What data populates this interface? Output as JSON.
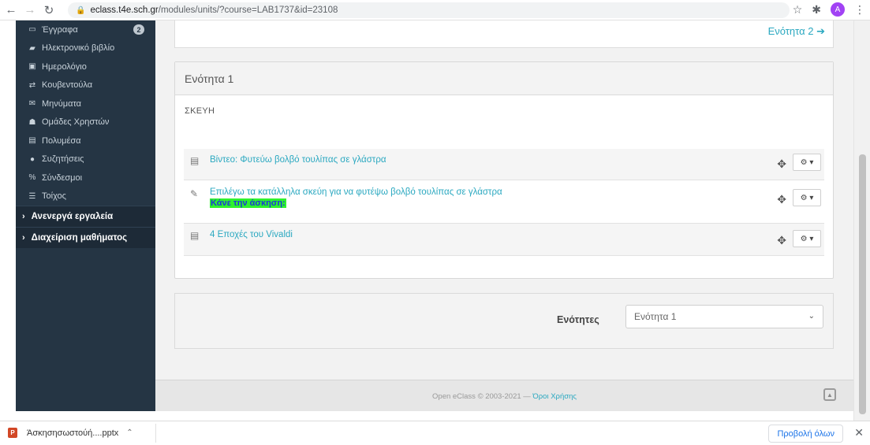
{
  "browser": {
    "url_host": "eclass.t4e.sch.gr",
    "url_path": "/modules/units/?course=LAB1737&id=23108",
    "avatar_letter": "A"
  },
  "sidebar": {
    "items": [
      {
        "label": "Έγγραφα",
        "icon": "folder-icon",
        "glyph": "▭",
        "badge": "2"
      },
      {
        "label": "Ηλεκτρονικό βιβλίο",
        "icon": "book-icon",
        "glyph": "▰"
      },
      {
        "label": "Ημερολόγιο",
        "icon": "calendar-icon",
        "glyph": "▣"
      },
      {
        "label": "Κουβεντούλα",
        "icon": "exchange-icon",
        "glyph": "⇄"
      },
      {
        "label": "Μηνύματα",
        "icon": "envelope-icon",
        "glyph": "✉"
      },
      {
        "label": "Ομάδες Χρηστών",
        "icon": "users-icon",
        "glyph": "☗"
      },
      {
        "label": "Πολυμέσα",
        "icon": "film-icon",
        "glyph": "▤"
      },
      {
        "label": "Συζητήσεις",
        "icon": "comments-icon",
        "glyph": "●"
      },
      {
        "label": "Σύνδεσμοι",
        "icon": "link-icon",
        "glyph": "%"
      },
      {
        "label": "Τοίχος",
        "icon": "list-icon",
        "glyph": "☰"
      }
    ],
    "groups": [
      {
        "label": "Ανενεργά εργαλεία"
      },
      {
        "label": "Διαχείριση μαθήματος"
      }
    ]
  },
  "main": {
    "next_unit_link": "Ενότητα 2",
    "unit_title": "Ενότητα 1",
    "unit_description": "ΣΚΕΥΗ",
    "resources": [
      {
        "title": "Βίντεο: Φυτεύω βολβό τουλίπας σε γλάστρα",
        "icon": "film-icon",
        "glyph": "▤"
      },
      {
        "title": "Επιλέγω τα κατάλληλα σκεύη για να φυτέψω βολβό τουλίπας σε γλάστρα",
        "icon": "edit-icon",
        "glyph": "✎",
        "highlight": "Κάνε την άσκηση:"
      },
      {
        "title": "4 Εποχές του Vivaldi",
        "icon": "film-icon",
        "glyph": "▤"
      }
    ],
    "units_label": "Ενότητες",
    "units_select_value": "Ενότητα 1"
  },
  "footer": {
    "copyright": "Open eClass © 2003-2021 — ",
    "terms": "Όροι Χρήσης"
  },
  "download_bar": {
    "file_name": "Άσκησησωστούή....pptx",
    "show_all": "Προβολή όλων"
  },
  "colors": {
    "sidebar_bg": "#253544",
    "link": "#2aa8c0",
    "highlight_bg": "#2ef22e",
    "highlight_text": "#1a3ad6"
  }
}
